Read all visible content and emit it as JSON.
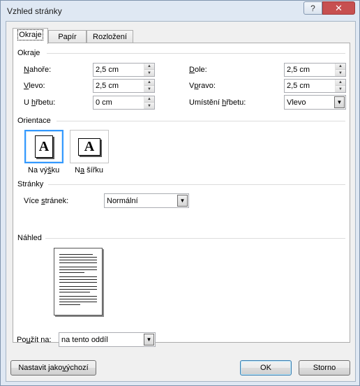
{
  "window": {
    "title": "Vzhled stránky",
    "help_label": "?",
    "close_label": "✕"
  },
  "tabs": [
    {
      "label": "Okraje",
      "active": true
    },
    {
      "label": "Papír",
      "active": false
    },
    {
      "label": "Rozložení",
      "active": false
    }
  ],
  "margins": {
    "section_title": "Okraje",
    "top": {
      "pre": "",
      "u": "N",
      "post": "ahoře:",
      "value": "2,5 cm"
    },
    "bottom": {
      "pre": "",
      "u": "D",
      "post": "ole:",
      "value": "2,5 cm"
    },
    "left": {
      "pre": "",
      "u": "V",
      "post": "levo:",
      "value": "2,5 cm"
    },
    "right": {
      "pre": "V",
      "u": "p",
      "post": "ravo:",
      "value": "2,5 cm"
    },
    "gutter": {
      "pre": "U ",
      "u": "h",
      "post": "řbetu:",
      "value": "0 cm"
    },
    "gutter_pos": {
      "pre": "Umístění ",
      "u": "h",
      "post": "řbetu:",
      "value": "Vlevo"
    }
  },
  "orientation": {
    "section_title": "Orientace",
    "portrait": {
      "icon_letter": "A",
      "pre": "Na vý",
      "u": "š",
      "post": "ku"
    },
    "landscape": {
      "icon_letter": "A",
      "pre": "N",
      "u": "a",
      "post": " šířku"
    }
  },
  "pages": {
    "section_title": "Stránky",
    "multiple": {
      "pre": "Více ",
      "u": "s",
      "post": "tránek:",
      "value": "Normální"
    }
  },
  "preview": {
    "section_title": "Náhled"
  },
  "apply_to": {
    "pre": "Po",
    "u": "u",
    "post": "žít na:",
    "value": "na tento oddíl"
  },
  "buttons": {
    "set_default": {
      "pre": "Nastavit jako ",
      "u": "v",
      "post": "ýchozí"
    },
    "ok": "OK",
    "cancel": "Storno"
  }
}
